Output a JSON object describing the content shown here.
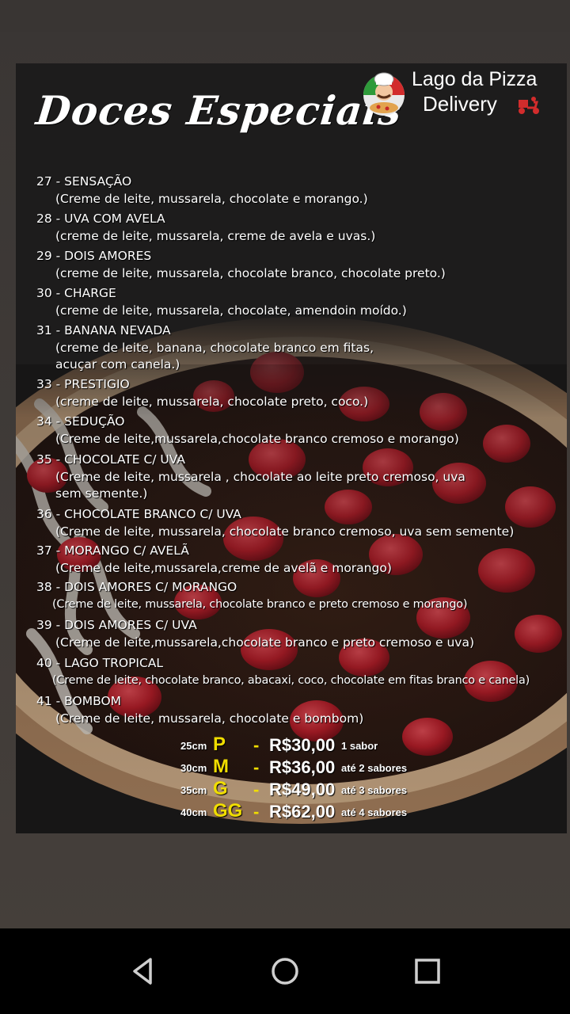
{
  "poster": {
    "title": "Doces Especiais",
    "brand": {
      "name": "Lago da Pizza",
      "subtitle": "Delivery"
    },
    "items": [
      {
        "title": "27 - SENSAÇÃO",
        "desc": "(Creme de leite, mussarela, chocolate e morango.)"
      },
      {
        "title": "28 - UVA COM AVELA",
        "desc": "(creme de leite, mussarela, creme de avela e uvas.)"
      },
      {
        "title": "29 - DOIS AMORES",
        "desc": "(creme de leite, mussarela, chocolate branco, chocolate preto.)"
      },
      {
        "title": "30 - CHARGE",
        "desc": "(creme de leite, mussarela, chocolate, amendoin moído.)"
      },
      {
        "title": "31 - BANANA NEVADA",
        "desc": "(creme de leite, banana, chocolate branco em fitas,\nacuçar com canela.)"
      },
      {
        "title": "33 - PRESTIGIO",
        "desc": "(creme de leite, mussarela, chocolate preto, coco.)"
      },
      {
        "title": "34 - SEDUÇÃO",
        "desc": "(Creme de leite,mussarela,chocolate branco cremoso e morango)"
      },
      {
        "title": "35 - CHOCOLATE C/ UVA",
        "desc": "(Creme de leite, mussarela , chocolate ao leite preto cremoso, uva\nsem semente.)"
      },
      {
        "title": "36 - CHOCOLATE BRANCO C/ UVA",
        "desc": "(Creme de leite, mussarela, chocolate branco cremoso, uva sem semente)"
      },
      {
        "title": "37 - MORANGO C/ AVELÃ",
        "desc": "(Creme de leite,mussarela,creme de avelã e morango)"
      },
      {
        "title": "38 - DOIS AMORES C/ MORANGO",
        "desc": "(Creme de leite, mussarela, chocolate branco e preto cremoso e morango)"
      },
      {
        "title": "39 - DOIS AMORES C/ UVA",
        "desc": "(Creme de leite,mussarela,chocolate branco e preto cremoso e uva)"
      },
      {
        "title": "40 - LAGO TROPICAL",
        "desc": "(Creme de leite, chocolate branco, abacaxi, coco, chocolate em fitas branco e canela)"
      },
      {
        "title": "41 - BOMBOM",
        "desc": "(Creme de leite, mussarela, chocolate e bombom)"
      }
    ],
    "prices": [
      {
        "diameter": "25cm",
        "size": "P",
        "price": "R$30,00",
        "note": "1 sabor"
      },
      {
        "diameter": "30cm",
        "size": "M",
        "price": "R$36,00",
        "note": "até 2 sabores"
      },
      {
        "diameter": "35cm",
        "size": "G",
        "price": "R$49,00",
        "note": "até 3 sabores"
      },
      {
        "diameter": "40cm",
        "size": "GG",
        "price": "R$62,00",
        "note": "até 4 sabores"
      }
    ]
  },
  "navbar": {
    "buttons": [
      {
        "name": "back-icon"
      },
      {
        "name": "home-icon"
      },
      {
        "name": "recents-icon"
      }
    ]
  },
  "colors": {
    "price_size": "#f0dd00",
    "strawberry": "#c8202a",
    "chocolate": "#3a1c12",
    "crust": "#c9a37a"
  }
}
